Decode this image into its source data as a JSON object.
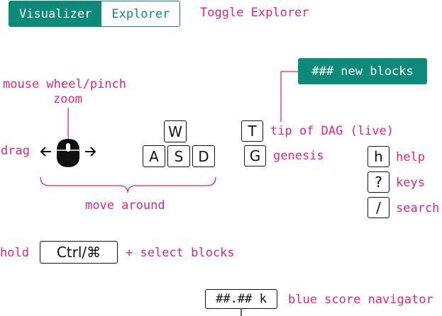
{
  "toggle": {
    "visualizer_label": "Visualizer",
    "explorer_label": "Explorer",
    "caption": "Toggle Explorer"
  },
  "new_blocks": {
    "label": "### new blocks"
  },
  "zoom": {
    "line1": "mouse wheel/pinch",
    "line2": "zoom"
  },
  "drag": {
    "label": "drag"
  },
  "move": {
    "keys": {
      "w": "W",
      "a": "A",
      "s": "S",
      "d": "D"
    },
    "label": "move around"
  },
  "tip": {
    "key": "T",
    "label": "tip of DAG (live)"
  },
  "genesis": {
    "key": "G",
    "label": "genesis"
  },
  "help": {
    "key": "h",
    "label": "help"
  },
  "keys_shortcut": {
    "key": "?",
    "label": "keys"
  },
  "search": {
    "key": "/",
    "label": "search"
  },
  "select": {
    "prefix": "hold",
    "key": "Ctrl/⌘",
    "suffix": "+ select blocks"
  },
  "blue_score": {
    "value": "##.## k",
    "label": "blue score navigator"
  },
  "colors": {
    "accent_teal": "#0e8a78",
    "annotation_pink": "#e0267c",
    "ink": "#111111"
  },
  "icons": [
    "mouse-icon",
    "arrow-left-icon",
    "arrow-right-icon"
  ]
}
